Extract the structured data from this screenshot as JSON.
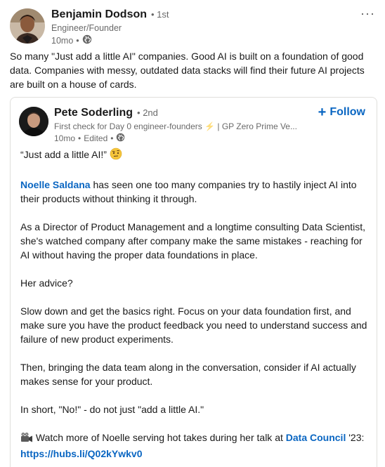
{
  "post": {
    "more_label": "···",
    "author": {
      "name": "Benjamin Dodson",
      "degree": "• 1st",
      "headline": "Engineer/Founder",
      "time": "10mo",
      "dot": "•"
    },
    "text": "So many \"Just add a little AI\" companies. Good AI is built on a foundation of good data. Companies with messy, outdated data stacks will find their future AI projects are built on a house of cards."
  },
  "repost": {
    "author": {
      "name": "Pete Soderling",
      "degree": "• 2nd",
      "headline": "First check for Day 0 engineer-founders ⚡ | GP Zero Prime Ve...",
      "time": "10mo",
      "edited": "Edited",
      "dot1": "•",
      "dot2": "•"
    },
    "follow_label": "Follow",
    "follow_plus": "+",
    "paragraphs": {
      "p1": "“Just add a little AI!”",
      "p2_mention": "Noelle Saldana",
      "p2_rest": " has seen one too many companies try to hastily inject AI into their products without thinking it through.",
      "p3": "As a Director of Product Management and a longtime consulting Data Scientist, she's watched company after company make the same mistakes - reaching for AI without having the proper data foundations in place.",
      "p4": "Her advice?",
      "p5": "Slow down and get the basics right. Focus on your data foundation first, and make sure you have the product feedback you need to understand success and failure of new product experiments.",
      "p6": "Then, bringing the data team along in the conversation, consider if AI actually makes sense for your product.",
      "p7": "In short, \"No!\" - do not just \"add a little AI.\"",
      "p8_pre": " Watch more of Noelle serving hot takes during her talk at ",
      "p8_link1": "Data Council",
      "p8_mid": " '23: ",
      "p8_link2": "https://hubs.li/Q02kYwkv0"
    }
  },
  "icons": {
    "globe": "globe-icon",
    "emoji_thinking": "raised-eyebrow-emoji",
    "emoji_camera": "movie-camera-emoji",
    "more": "more-options-icon"
  },
  "colors": {
    "link": "#0a66c2",
    "secondary_text": "#666666",
    "border": "#e0dfdc"
  }
}
